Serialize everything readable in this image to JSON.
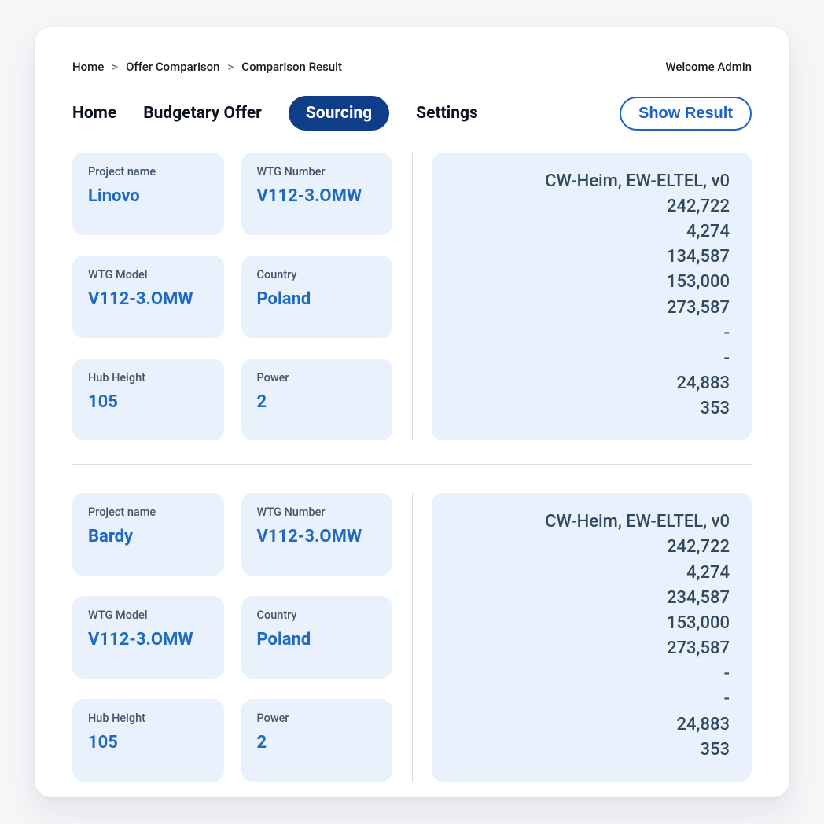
{
  "breadcrumb": [
    "Home",
    "Offer Comparison",
    "Comparison Result"
  ],
  "welcome": "Welcome Admin",
  "tabs": {
    "home": "Home",
    "budgetary": "Budgetary Offer",
    "sourcing": "Sourcing",
    "settings": "Settings"
  },
  "show_result": "Show Result",
  "field_labels": {
    "project_name": "Project name",
    "wtg_number": "WTG Number",
    "wtg_model": "WTG Model",
    "country": "Country",
    "hub_height": "Hub Height",
    "power": "Power"
  },
  "projects": [
    {
      "project_name": "Linovo",
      "wtg_number": "V112-3.OMW",
      "wtg_model": "V112-3.OMW",
      "country": "Poland",
      "hub_height": "105",
      "power": "2",
      "result_title": "CW-Heim, EW-ELTEL, v0",
      "result_values": [
        "242,722",
        "4,274",
        "134,587",
        "153,000",
        "273,587",
        "-",
        "-",
        "24,883",
        "353"
      ]
    },
    {
      "project_name": "Bardy",
      "wtg_number": "V112-3.OMW",
      "wtg_model": "V112-3.OMW",
      "country": "Poland",
      "hub_height": "105",
      "power": "2",
      "result_title": "CW-Heim, EW-ELTEL, v0",
      "result_values": [
        "242,722",
        "4,274",
        "234,587",
        "153,000",
        "273,587",
        "-",
        "-",
        "24,883",
        "353"
      ]
    }
  ]
}
